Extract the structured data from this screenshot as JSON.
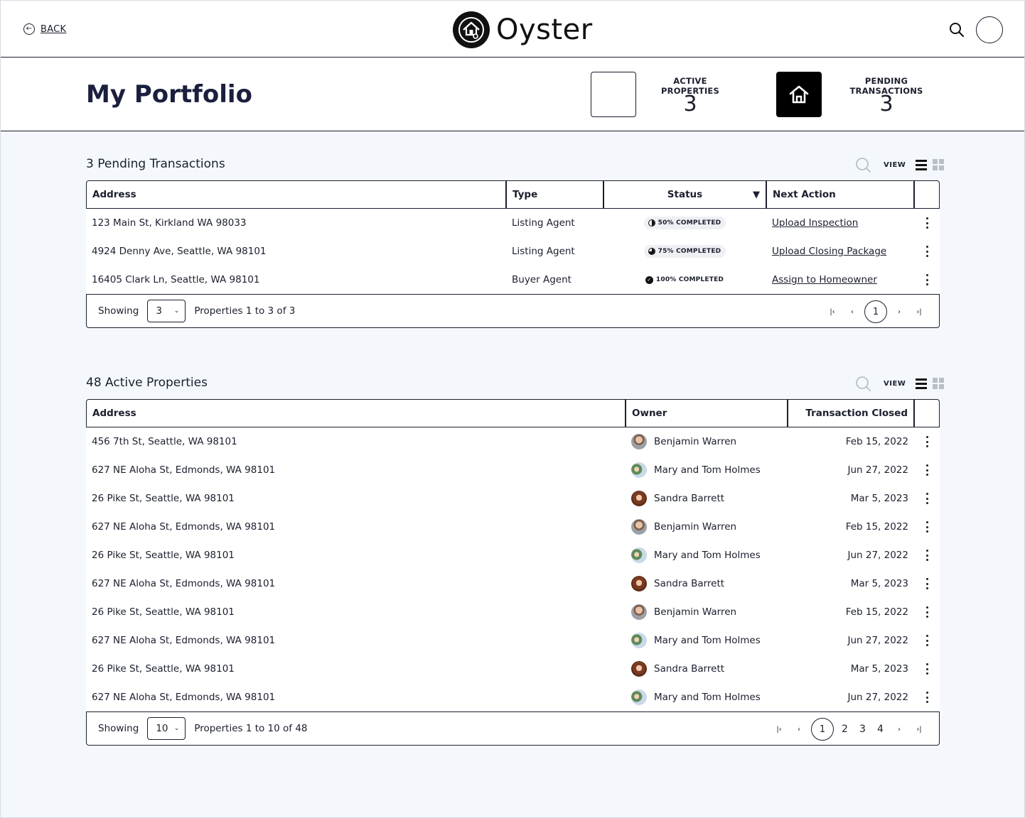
{
  "header": {
    "back_label": "BACK",
    "brand": "Oyster"
  },
  "portfolio": {
    "title": "My Portfolio",
    "stats": [
      {
        "label": "ACTIVE PROPERTIES",
        "value": "3"
      },
      {
        "label": "PENDING TRANSACTIONS",
        "value": "3"
      }
    ]
  },
  "pending": {
    "title": "3 Pending Transactions",
    "view_label": "VIEW",
    "columns": [
      "Address",
      "Type",
      "Status",
      "Next Action"
    ],
    "rows": [
      {
        "address": "123 Main St, Kirkland WA 98033",
        "type": "Listing Agent",
        "status": "50% COMPLETED",
        "progress": 50,
        "action": "Upload Inspection"
      },
      {
        "address": "4924 Denny Ave, Seattle, WA 98101",
        "type": "Listing Agent",
        "status": "75% COMPLETED",
        "progress": 75,
        "action": "Upload Closing Package"
      },
      {
        "address": "16405 Clark Ln, Seattle, WA 98101",
        "type": "Buyer Agent",
        "status": "100% COMPLETED",
        "progress": 100,
        "action": "Assign to Homeowner"
      }
    ],
    "footer": {
      "showing_label": "Showing",
      "page_size": "3",
      "range": "Properties 1 to 3 of 3",
      "current_page": "1"
    }
  },
  "active": {
    "title": "48 Active Properties",
    "view_label": "VIEW",
    "columns": [
      "Address",
      "Owner",
      "Transaction Closed"
    ],
    "rows": [
      {
        "address": "456 7th St, Seattle, WA 98101",
        "owner": "Benjamin Warren",
        "closed": "Feb 15, 2022"
      },
      {
        "address": "627 NE Aloha St, Edmonds, WA 98101",
        "owner": "Mary and Tom Holmes",
        "closed": "Jun 27, 2022"
      },
      {
        "address": "26 Pike St, Seattle, WA 98101",
        "owner": "Sandra Barrett",
        "closed": "Mar 5, 2023"
      },
      {
        "address": "627 NE Aloha St, Edmonds, WA 98101",
        "owner": "Benjamin Warren",
        "closed": "Feb 15, 2022"
      },
      {
        "address": "26 Pike St, Seattle, WA 98101",
        "owner": "Mary and Tom Holmes",
        "closed": "Jun 27, 2022"
      },
      {
        "address": "627 NE Aloha St, Edmonds, WA 98101",
        "owner": "Sandra Barrett",
        "closed": "Mar 5, 2023"
      },
      {
        "address": "26 Pike St, Seattle, WA 98101",
        "owner": "Benjamin Warren",
        "closed": "Feb 15, 2022"
      },
      {
        "address": "627 NE Aloha St, Edmonds, WA 98101",
        "owner": "Mary and Tom Holmes",
        "closed": "Jun 27, 2022"
      },
      {
        "address": "26 Pike St, Seattle, WA 98101",
        "owner": "Sandra Barrett",
        "closed": "Mar 5, 2023"
      },
      {
        "address": "627 NE Aloha St, Edmonds, WA 98101",
        "owner": "Mary and Tom Holmes",
        "closed": "Jun 27, 2022"
      }
    ],
    "footer": {
      "showing_label": "Showing",
      "page_size": "10",
      "range": "Properties 1 to 10 of 48",
      "current_page": "1",
      "pages": [
        "2",
        "3",
        "4"
      ]
    }
  },
  "icons": {
    "back": "back-arrow-icon",
    "search": "search-icon",
    "home": "home-icon",
    "list": "list-view-icon",
    "grid": "grid-view-icon",
    "menu": "kebab-menu-icon",
    "sort": "sort-down-icon"
  }
}
